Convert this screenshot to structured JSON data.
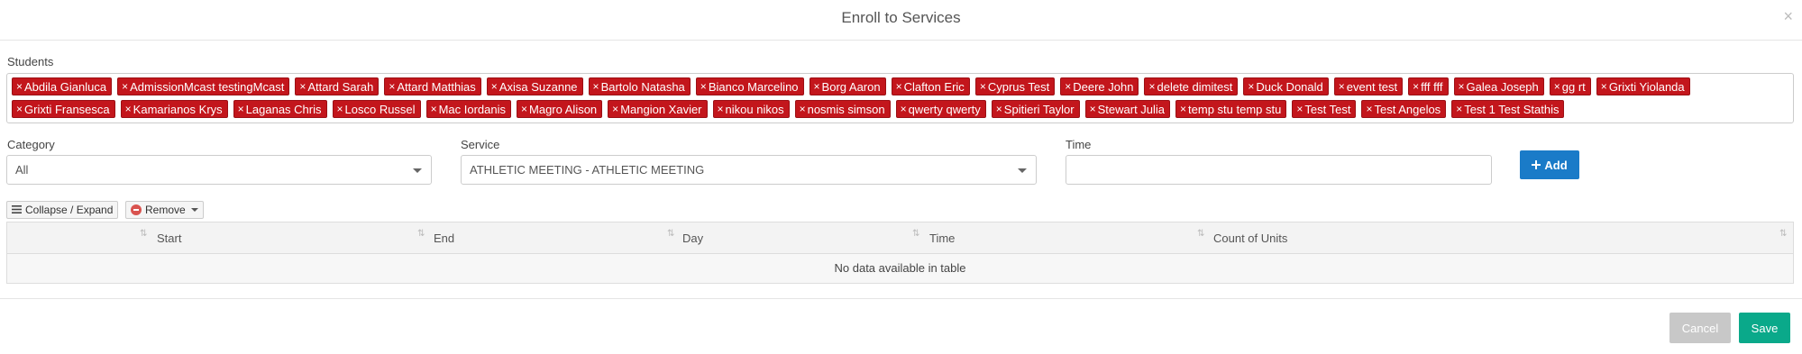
{
  "modal": {
    "title": "Enroll to Services",
    "close_glyph": "×"
  },
  "students": {
    "label": "Students",
    "tags": [
      "Abdila Gianluca",
      "AdmissionMcast testingMcast",
      "Attard Sarah",
      "Attard Matthias",
      "Axisa Suzanne",
      "Bartolo Natasha",
      "Bianco Marcelino",
      "Borg Aaron",
      "Clafton Eric",
      "Cyprus Test",
      "Deere John",
      "delete dimitest",
      "Duck Donald",
      "event test",
      "fff fff",
      "Galea Joseph",
      "gg rt",
      "Grixti Yiolanda",
      "Grixti Fransesca",
      "Kamarianos Krys",
      "Laganas Chris",
      "Losco Russel",
      "Mac Iordanis",
      "Magro Alison",
      "Mangion Xavier",
      "nikou nikos",
      "nosmis simson",
      "qwerty qwerty",
      "Spitieri Taylor",
      "Stewart Julia",
      "temp stu temp stu",
      "Test Test",
      "Test Angelos",
      "Test 1 Test Stathis"
    ],
    "remove_glyph": "×"
  },
  "filters": {
    "category_label": "Category",
    "category_value": "All",
    "service_label": "Service",
    "service_value": "ATHLETIC MEETING - ATHLETIC MEETING",
    "time_label": "Time",
    "time_value": "",
    "add_label": "Add"
  },
  "toolbar": {
    "collapse_label": "Collapse / Expand",
    "remove_label": "Remove"
  },
  "table": {
    "columns": [
      "Start",
      "End",
      "Day",
      "Time",
      "Count of Units"
    ],
    "empty_message": "No data available in table"
  },
  "footer": {
    "cancel_label": "Cancel",
    "save_label": "Save"
  },
  "colors": {
    "tag": "#c3161c",
    "add_button": "#1a7bc8",
    "save_button": "#0aa98a",
    "cancel_button": "#c8c8c8"
  },
  "icons": {
    "close": "close-icon",
    "tag_remove": "remove-x-icon",
    "add": "plus-icon",
    "collapse": "list-icon",
    "remove": "minus-circle-icon",
    "sort": "sort-icon"
  }
}
